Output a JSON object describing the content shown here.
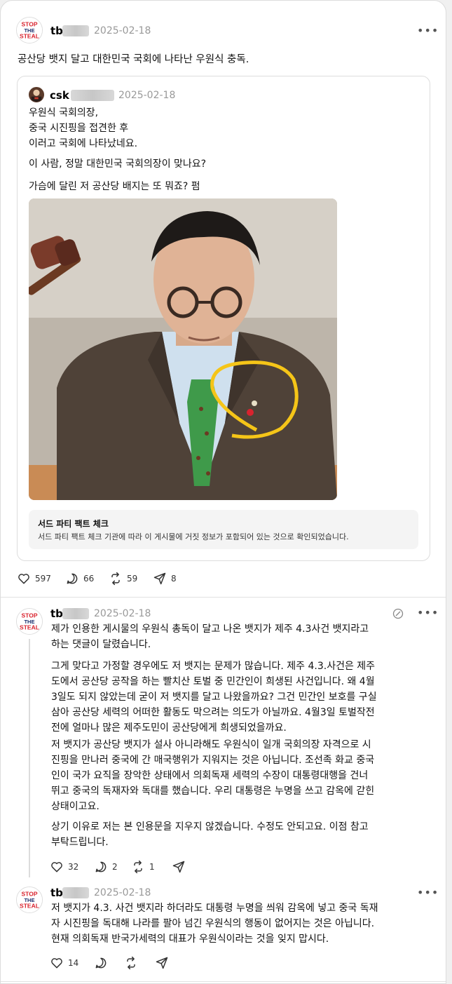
{
  "post": {
    "username": "tb",
    "date": "2025-02-18",
    "text": "공산당 뱃지 달고 대한민국 국회에 나타난 우원식 충독.",
    "quoted": {
      "username": "csk",
      "date": "2025-02-18",
      "lines": [
        "우원식 국회의장,",
        "중국 시진핑을 접견한 후",
        "이러고 국회에 나타났네요."
      ],
      "para2": "이 사람, 정말 대한민국 국회의장이 맞나요?",
      "para3": "가슴에 달린 저 공산당 배지는 또 뭐죠? 펌",
      "fact_title": "서드 파티 팩트 체크",
      "fact_text": "서드 파티 팩트 체크 기관에 따라 이 게시물에 거짓 정보가 포함되어 있는 것으로 확인되었습니다."
    },
    "stats": {
      "likes": "597",
      "comments": "66",
      "reposts": "59",
      "shares": "8"
    }
  },
  "reply1": {
    "username": "tb",
    "date": "2025-02-18",
    "p1": [
      "제가 인용한 게시물의 우원식 총독이 달고 나온 뱃지가 제주 4.3사건 뱃지라고",
      "하는 댓글이 달렸습니다."
    ],
    "p2": [
      "그게 맞다고 가정할 경우에도 저 뱃지는 문제가 많습니다. 제주 4.3.사건은 제주",
      "도에서 공산당 공작을 하는 빨치산 토벌 중 민간인이 희생된 사건입니다. 왜 4월",
      "3일도 되지 않았는데 굳이 저 뱃지를 달고 나왔을까요? 그건 민간인 보호를 구실",
      "삼아 공산당 세력의 어떠한 활동도 막으려는 의도가 아닐까요. 4월3일 토벌작전",
      "전에 얼마나 많은 제주도민이 공산당에게 희생되었을까요."
    ],
    "p3": [
      "저 뱃지가 공산당 뱃지가 설사 아니라해도 우원식이 일개 국회의장 자격으로 시",
      "진핑을 만나러 중국에 간 매국행위가 지워지는 것은 아닙니다. 조선족 화교 중국",
      "인이 국가 요직을 장악한 상태에서 의회독재 세력의 수장이 대통령대행을 건너",
      "뛰고 중국의 독재자와 독대를 했습니다. 우리 대통령은 누명을 쓰고 감옥에 갇힌",
      "상태이고요."
    ],
    "p4": [
      "상기 이유로 저는 본 인용문을 지우지 않겠습니다. 수정도 안되고요. 이점 참고",
      "부탁드립니다."
    ],
    "stats": {
      "likes": "32",
      "comments": "2",
      "reposts": "1"
    }
  },
  "reply2": {
    "username": "tb",
    "date": "2025-02-18",
    "p1": [
      "저 뱃지가 4.3. 사건 뱃지라 하더라도 대통령 누명을 씌워 감옥에 넣고 중국 독재",
      "자 시진핑을 독대해 나라를 팔아 넘긴 우원식의 행동이 없어지는 것은 아닙니다.",
      "현재 의회독재 반국가세력의 대표가 우원식이라는 것을 잊지 맙시다."
    ],
    "stats": {
      "likes": "14"
    }
  },
  "avatar_text": {
    "l1": "STOP",
    "l2": "THE",
    "l3": "STEAL"
  },
  "colors": {
    "stop_red": "#d9232e",
    "stop_blue": "#1c2f6e",
    "circle_yellow": "#f5c518",
    "tie_green": "#3f9a4a"
  },
  "icons": [
    "more-icon",
    "heart-icon",
    "comment-icon",
    "repost-icon",
    "share-icon",
    "edit-icon"
  ]
}
